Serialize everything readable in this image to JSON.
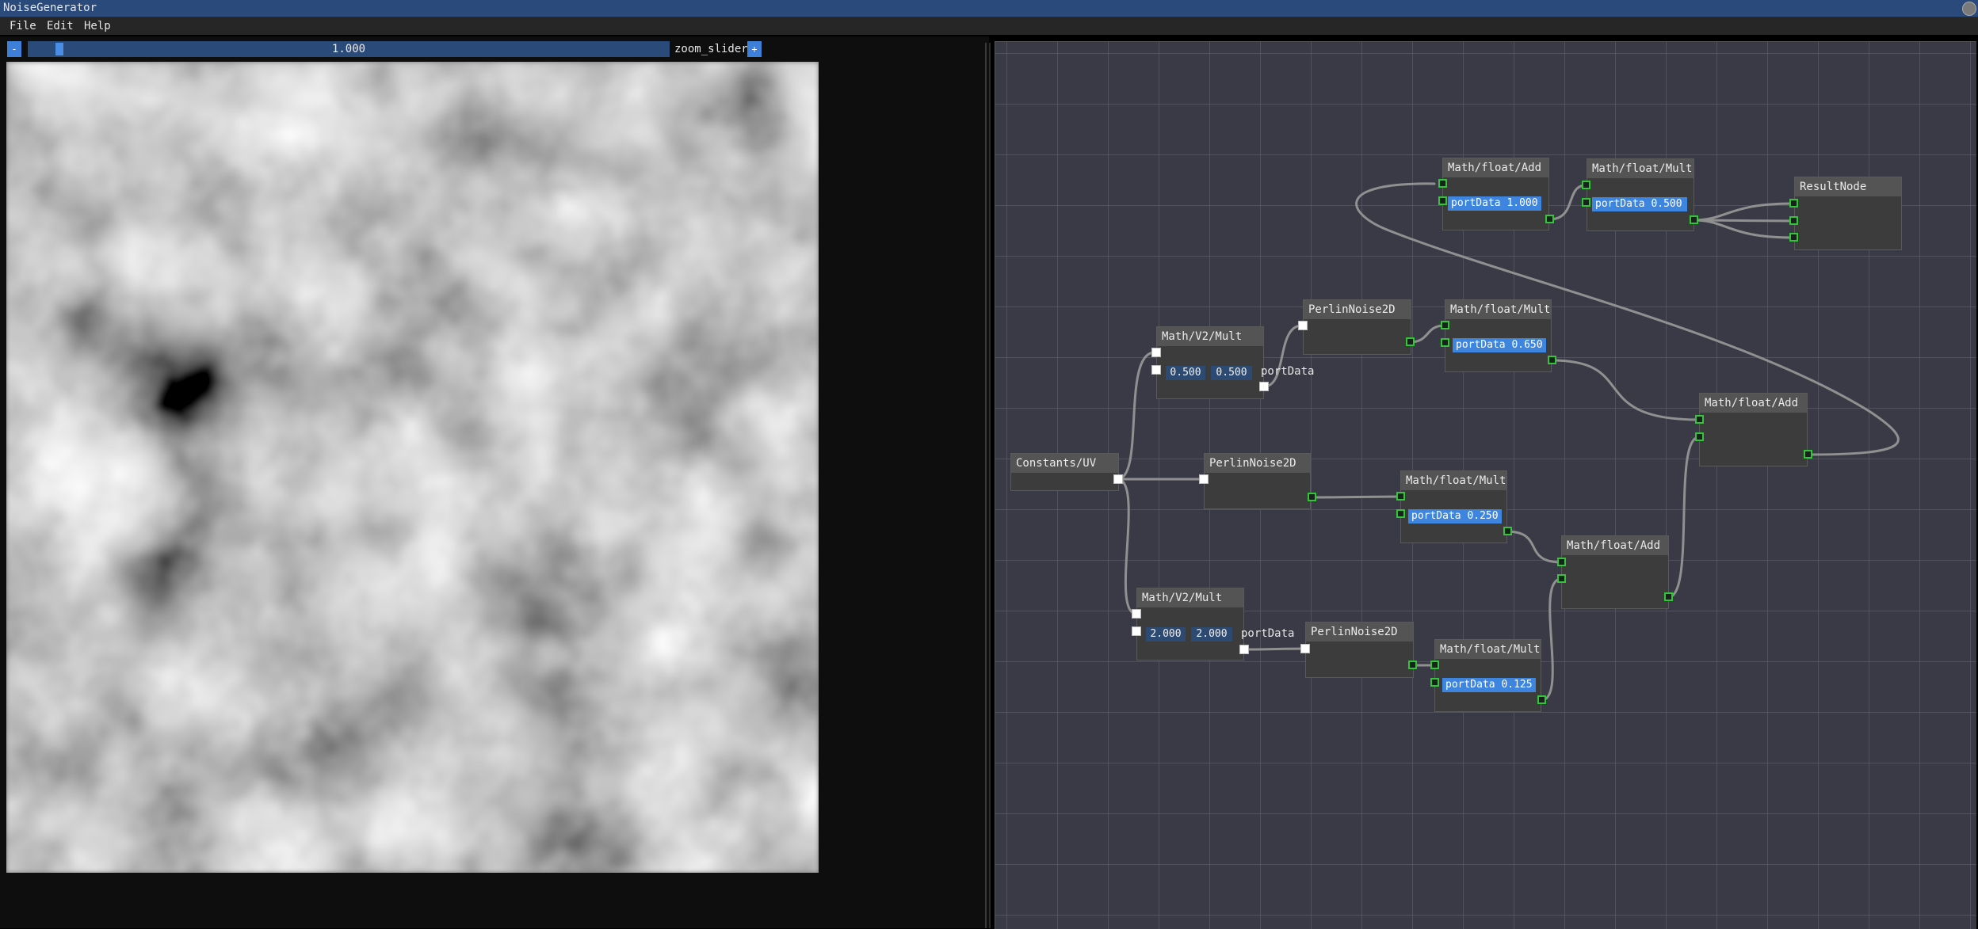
{
  "window": {
    "title": "NoiseGenerator"
  },
  "menu": [
    "File",
    "Edit",
    "Help"
  ],
  "zoom": {
    "minus": "-",
    "plus": "+",
    "value": "1.000",
    "label": "zoom_slider"
  },
  "nodes": {
    "uv": {
      "title": "Constants/UV"
    },
    "v2mult_a": {
      "title": "Math/V2/Mult",
      "x": "0.500",
      "y": "0.500",
      "port": "portData"
    },
    "v2mult_b": {
      "title": "Math/V2/Mult",
      "x": "2.000",
      "y": "2.000",
      "port": "portData"
    },
    "perlin_a": {
      "title": "PerlinNoise2D"
    },
    "perlin_b": {
      "title": "PerlinNoise2D"
    },
    "perlin_c": {
      "title": "PerlinNoise2D"
    },
    "mult_top": {
      "title": "Math/float/Mult",
      "field": "portData  0.500"
    },
    "mult_065": {
      "title": "Math/float/Mult",
      "field": "portData  0.650"
    },
    "mult_025": {
      "title": "Math/float/Mult",
      "field": "portData  0.250"
    },
    "mult_0125": {
      "title": "Math/float/Mult",
      "field": "portData  0.125"
    },
    "add_top": {
      "title": "Math/float/Add",
      "field": "portData  1.000"
    },
    "add_mid": {
      "title": "Math/float/Add"
    },
    "add_low": {
      "title": "Math/float/Add"
    },
    "result": {
      "title": "ResultNode"
    }
  }
}
